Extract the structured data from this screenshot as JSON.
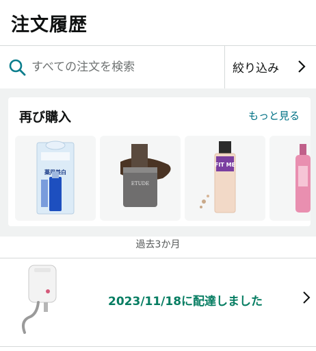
{
  "page": {
    "title": "注文履歴"
  },
  "search": {
    "placeholder": "すべての注文を検索",
    "filter_label": "絞り込み"
  },
  "buy_again": {
    "title": "再び購入",
    "see_more": "もっと見る",
    "items": [
      {
        "package_text": "薬用美白"
      },
      {
        "brand_text": "ETUDE"
      },
      {
        "label_text": "FIT ME"
      },
      {
        "label_text": ""
      }
    ]
  },
  "orders_section": {
    "label": "過去3か月"
  },
  "orders": [
    {
      "status": "2023/11/18に配達しました"
    }
  ],
  "colors": {
    "accent_link": "#007185",
    "delivered_green": "#067d62",
    "search_icon": "#0a7d8c"
  }
}
